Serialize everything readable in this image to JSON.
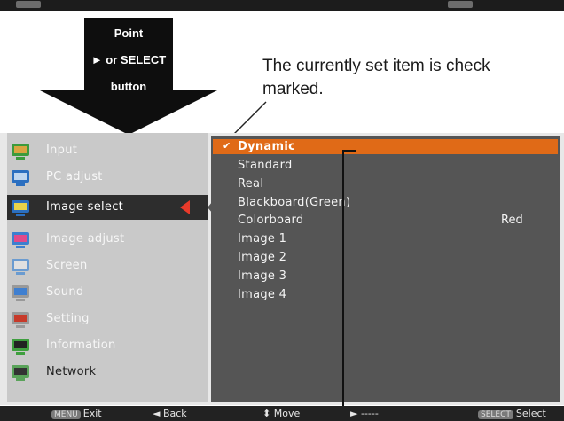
{
  "arrow": {
    "line1": "Point",
    "line2": "► or SELECT",
    "line3": "button"
  },
  "callout": "The currently set item is check marked.",
  "colors": {
    "highlight": "#e06a17",
    "selected_arrow": "#e83a2a",
    "panel_dark": "#555555"
  },
  "menu": {
    "items": [
      {
        "label": "Input",
        "icon": "input-icon"
      },
      {
        "label": "PC adjust",
        "icon": "pc-adjust-icon"
      },
      {
        "label": "Image select",
        "icon": "image-select-icon"
      },
      {
        "label": "Image adjust",
        "icon": "image-adjust-icon"
      },
      {
        "label": "Screen",
        "icon": "screen-icon"
      },
      {
        "label": "Sound",
        "icon": "sound-icon"
      },
      {
        "label": "Setting",
        "icon": "setting-icon"
      },
      {
        "label": "Information",
        "icon": "information-icon"
      },
      {
        "label": "Network",
        "icon": "network-icon"
      }
    ],
    "selected": "Image select"
  },
  "options": {
    "check": "✔",
    "items": [
      "Dynamic",
      "Standard",
      "Real",
      "Blackboard(Green)",
      "Colorboard",
      "Image 1",
      "Image 2",
      "Image 3",
      "Image 4"
    ],
    "colorboard_value": "Red",
    "current": "Dynamic"
  },
  "footer": {
    "exit_key": "MENU",
    "exit": "Exit",
    "back_arrow": "◄",
    "back": "Back",
    "move_arrows": "⬍",
    "move": "Move",
    "right_arrow": "►",
    "dashes": "-----",
    "select_key": "SELECT",
    "select": "Select"
  }
}
